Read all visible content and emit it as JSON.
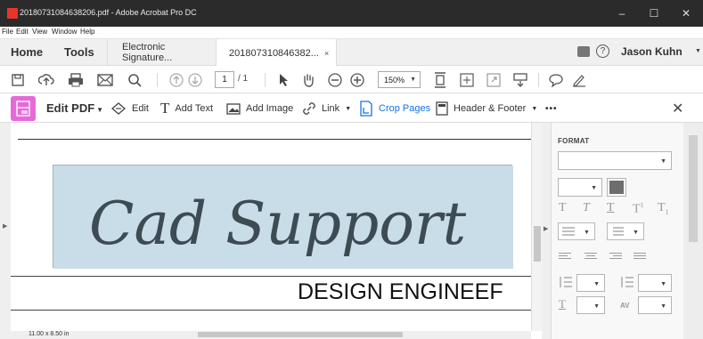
{
  "window": {
    "title": "20180731084638206.pdf - Adobe Acrobat Pro DC",
    "minimize": "–",
    "maximize": "☐",
    "close": "✕"
  },
  "menu": [
    "File",
    "Edit",
    "View",
    "Window",
    "Help"
  ],
  "tabs": {
    "home": "Home",
    "tools": "Tools",
    "doc_tabs": [
      {
        "label": "Electronic Signature...",
        "active": false
      },
      {
        "label": "201807310846382...",
        "active": true,
        "close": "×"
      }
    ]
  },
  "user": {
    "name": "Jason Kuhn",
    "chat_icon": "comment-icon",
    "help": "?"
  },
  "toolbar": {
    "page_current": "1",
    "page_total": "/ 1",
    "zoom": "150%"
  },
  "edit_toolbar": {
    "label": "Edit PDF",
    "items": [
      {
        "label": "Edit",
        "icon": "edit-cursor-icon"
      },
      {
        "label": "Add Text",
        "icon": "text-icon"
      },
      {
        "label": "Add Image",
        "icon": "image-icon"
      },
      {
        "label": "Link",
        "icon": "link-icon"
      },
      {
        "label": "Crop Pages",
        "icon": "crop-icon"
      },
      {
        "label": "Header & Footer",
        "icon": "header-footer-icon"
      }
    ],
    "more": "•••",
    "close": "✕"
  },
  "document": {
    "signature": "Cad Support",
    "heading": "DESIGN ENGINEEF",
    "signature_box_color": "#c9dde8"
  },
  "status": {
    "page_size": "11.00 x 8.50 in"
  },
  "panel": {
    "title": "FORMAT"
  },
  "colors": {
    "accent_pink": "#e56ad9",
    "crop_blue": "#1473e6",
    "titlebar": "#2b2b2b"
  }
}
